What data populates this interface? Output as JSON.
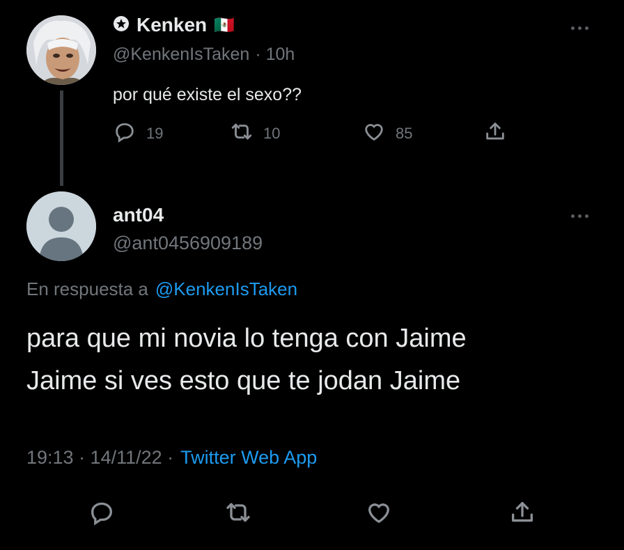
{
  "parent_tweet": {
    "display_name": "Kenken",
    "flag": "🇲🇽",
    "handle": "@KenkenIsTaken",
    "time": "· 10h",
    "text": "por qué existe el sexo??",
    "replies": "19",
    "retweets": "10",
    "likes": "85"
  },
  "reply_tweet": {
    "display_name": "ant04",
    "handle": "@ant0456909189",
    "reply_prefix": "En respuesta a",
    "reply_to": "@KenkenIsTaken",
    "text_line1": "para que mi novia lo tenga con Jaime",
    "text_line2": "Jaime si ves esto que te jodan Jaime",
    "timestamp": "19:13 · 14/11/22 ·",
    "source": "Twitter Web App"
  },
  "colors": {
    "background": "#000000",
    "text": "#e7e9ea",
    "muted": "#71767b",
    "accent": "#1d9bf0"
  },
  "icons": [
    "star-badge-icon",
    "reply-icon",
    "retweet-icon",
    "like-icon",
    "share-icon",
    "more-icon",
    "default-avatar-icon"
  ]
}
